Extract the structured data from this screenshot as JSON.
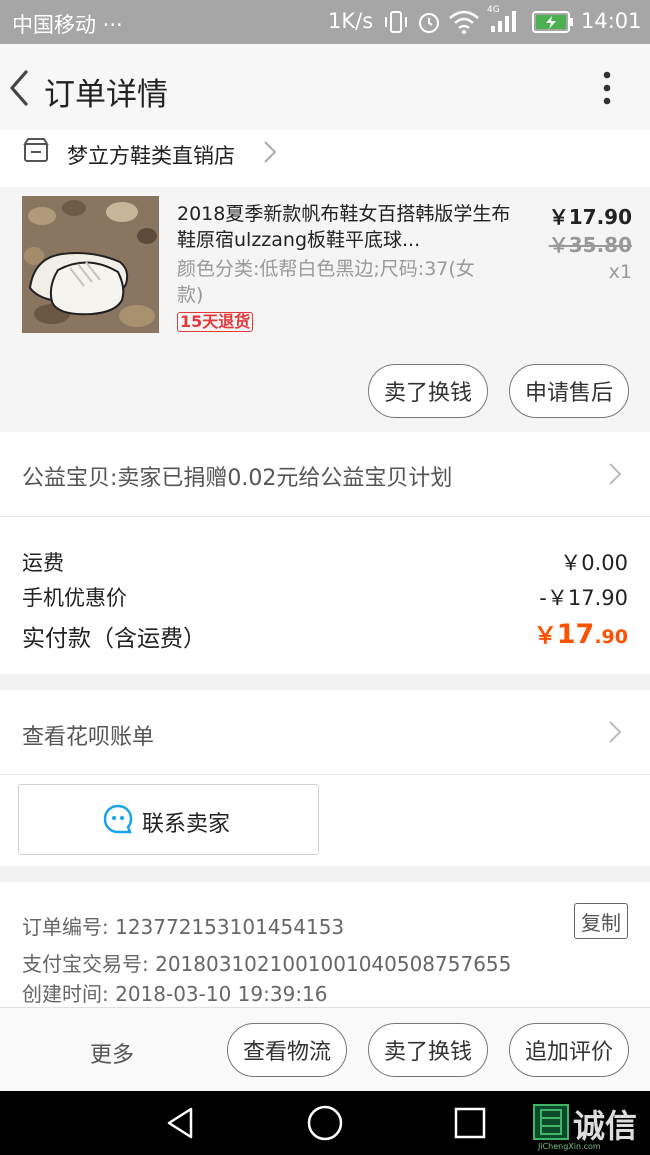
{
  "status_bar": {
    "carrier": "中国移动 ···",
    "net_speed": "1K/s",
    "network_type": "4G",
    "time": "14:01"
  },
  "header": {
    "title": "订单详情"
  },
  "shop": {
    "name": "梦立方鞋类直销店"
  },
  "product": {
    "title": "2018夏季新款帆布鞋女百搭韩版学生布鞋原宿ulzzang板鞋平底球...",
    "sku": "颜色分类:低帮白色黑边;尺码:37(女款)",
    "badge": "15天退货",
    "price": "￥17.90",
    "original_price": "￥35.80",
    "quantity": "x1",
    "buttons": {
      "sell": "卖了换钱",
      "after_sale": "申请售后"
    }
  },
  "charity": {
    "text": "公益宝贝:卖家已捐赠0.02元给公益宝贝计划"
  },
  "fees": {
    "shipping_label": "运费",
    "shipping_value": "￥0.00",
    "discount_label": "手机优惠价",
    "discount_value": "-￥17.90",
    "paid_label": "实付款（含运费）",
    "paid_symbol": "￥",
    "paid_int": "17",
    "paid_dec": ".90"
  },
  "huabei": {
    "text": "查看花呗账单"
  },
  "contact": {
    "label": "联系卖家"
  },
  "order_info": {
    "order_no": "订单编号: 123772153101454153",
    "copy_label": "复制",
    "alipay_no": "支付宝交易号: 2018031021001001040508757655",
    "created": "创建时间: 2018-03-10 19:39:16"
  },
  "bottom_bar": {
    "more": "更多",
    "logistics": "查看物流",
    "sell": "卖了换钱",
    "review": "追加评价"
  },
  "watermark": {
    "text": "诚信",
    "sub": "JiChengXin.com"
  },
  "colors": {
    "accent_orange": "#ff5000",
    "badge_red": "#e4393c",
    "contact_blue": "#1aa3e8"
  }
}
